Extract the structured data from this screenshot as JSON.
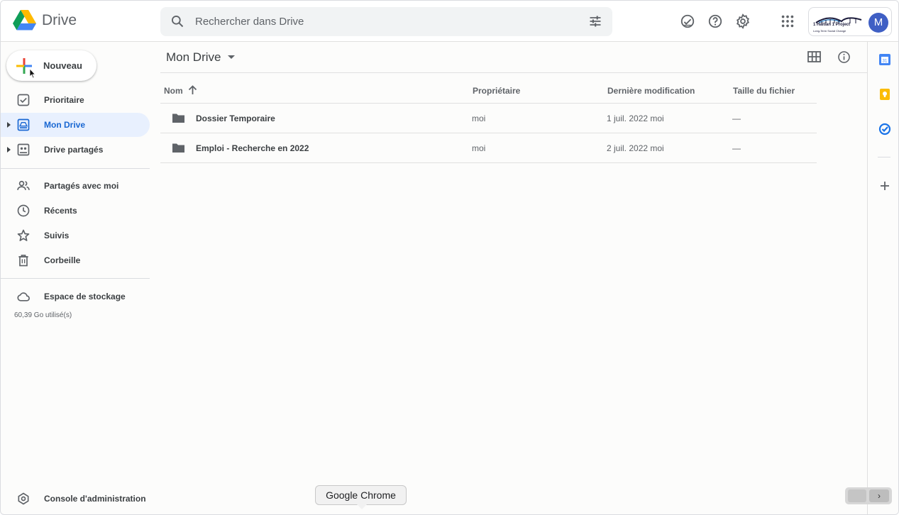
{
  "header": {
    "app_name": "Drive",
    "search_placeholder": "Rechercher dans Drive",
    "brand_line1": "1 Haitian 1 Project",
    "brand_line2": "Long-Term Social Change",
    "avatar_letter": "M"
  },
  "sidebar": {
    "new_label": "Nouveau",
    "items": [
      {
        "label": "Prioritaire",
        "icon": "priority-check-icon"
      },
      {
        "label": "Mon Drive",
        "icon": "my-drive-icon"
      },
      {
        "label": "Drive partagés",
        "icon": "shared-drives-icon"
      },
      {
        "label": "Partagés avec moi",
        "icon": "people-icon"
      },
      {
        "label": "Récents",
        "icon": "clock-icon"
      },
      {
        "label": "Suivis",
        "icon": "star-icon"
      },
      {
        "label": "Corbeille",
        "icon": "trash-icon"
      },
      {
        "label": "Espace de stockage",
        "icon": "cloud-icon"
      }
    ],
    "storage_used": "60,39 Go utilisé(s)",
    "admin_console": "Console d'administration"
  },
  "main": {
    "title": "Mon Drive",
    "columns": {
      "name": "Nom",
      "owner": "Propriétaire",
      "modified": "Dernière modification",
      "size": "Taille du fichier"
    },
    "rows": [
      {
        "name": "Dossier Temporaire",
        "owner": "moi",
        "modified": "1 juil. 2022",
        "modified_by": "moi",
        "size": "—"
      },
      {
        "name": "Emploi - Recherche en 2022",
        "owner": "moi",
        "modified": "2 juil. 2022",
        "modified_by": "moi",
        "size": "—"
      }
    ]
  },
  "tooltip": "Google Chrome",
  "colors": {
    "accent": "#1967d2",
    "active_bg": "#e8f0fe",
    "avatar": "#3f5fc4"
  }
}
